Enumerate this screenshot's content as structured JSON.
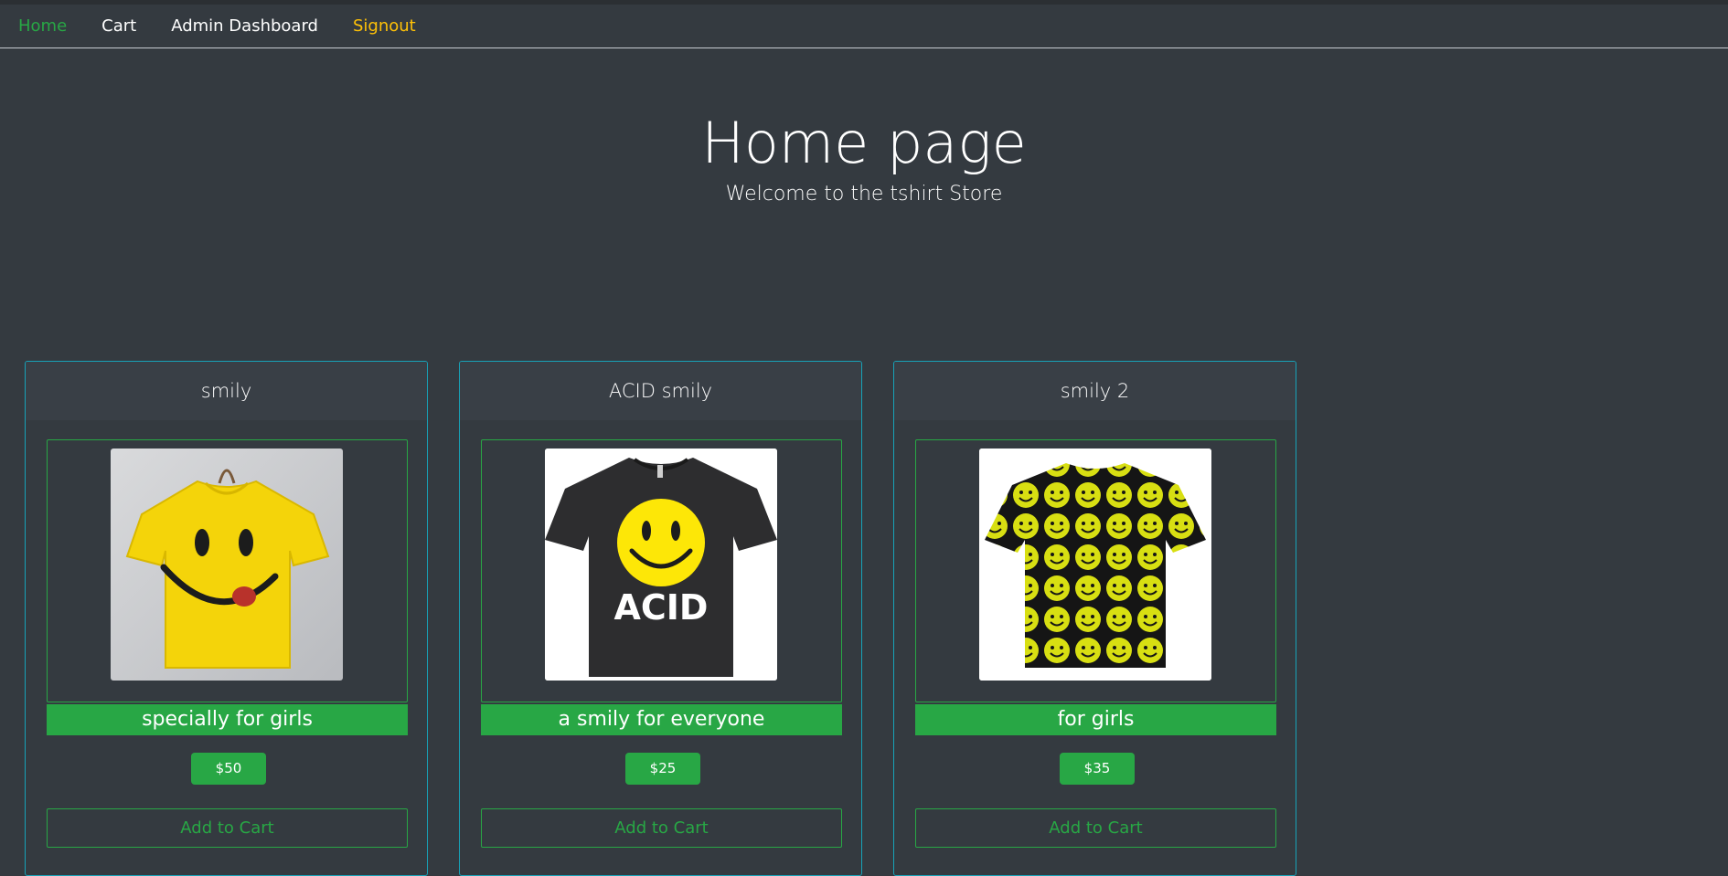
{
  "nav": {
    "home": "Home",
    "cart": "Cart",
    "admin": "Admin Dashboard",
    "signout": "Signout"
  },
  "hero": {
    "title": "Home page",
    "subtitle": "Welcome to the tshirt Store"
  },
  "products": [
    {
      "name": "smily",
      "description": "specially for girls",
      "price": "$50",
      "cta": "Add to Cart",
      "image": "yellow-smiley-tshirt-image"
    },
    {
      "name": "ACID smily",
      "description": "a smily for everyone",
      "price": "$25",
      "cta": "Add to Cart",
      "image": "black-acid-smiley-tshirt-image",
      "image_text": "ACID"
    },
    {
      "name": "smily 2",
      "description": "for girls",
      "price": "$35",
      "cta": "Add to Cart",
      "image": "smiley-pattern-tshirt-image"
    }
  ],
  "colors": {
    "background": "#343a40",
    "success": "#28a745",
    "warning": "#ffc107",
    "info": "#17a2b8"
  }
}
